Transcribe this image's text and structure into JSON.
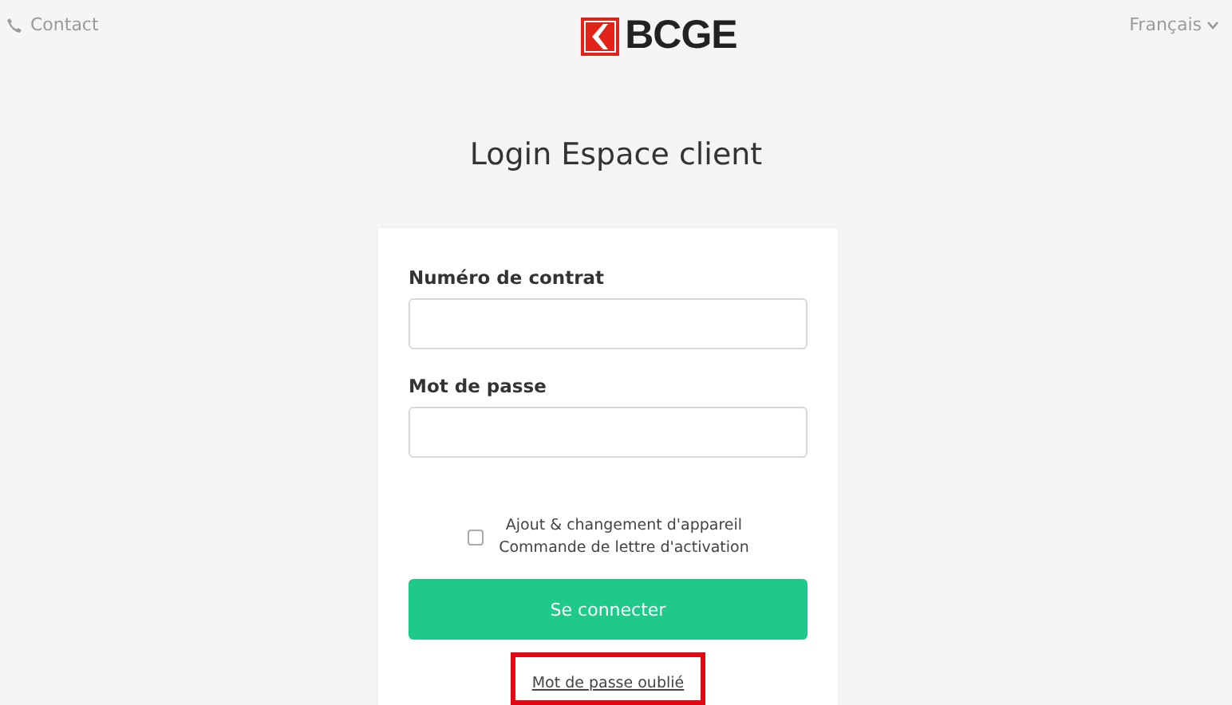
{
  "header": {
    "contact": "Contact",
    "logo": "BCGE",
    "language": "Français"
  },
  "title": "Login Espace client",
  "form": {
    "fields": [
      {
        "label": "Numéro de contrat"
      },
      {
        "label": "Mot de passe"
      }
    ],
    "checkbox": {
      "checked": false,
      "lines": [
        "Ajout & changement d'appareil",
        "Commande de lettre d'activation"
      ]
    },
    "submit": "Se connecter",
    "forgot_link": {
      "text": "Mot de passe oublié",
      "highlighted": true
    }
  }
}
